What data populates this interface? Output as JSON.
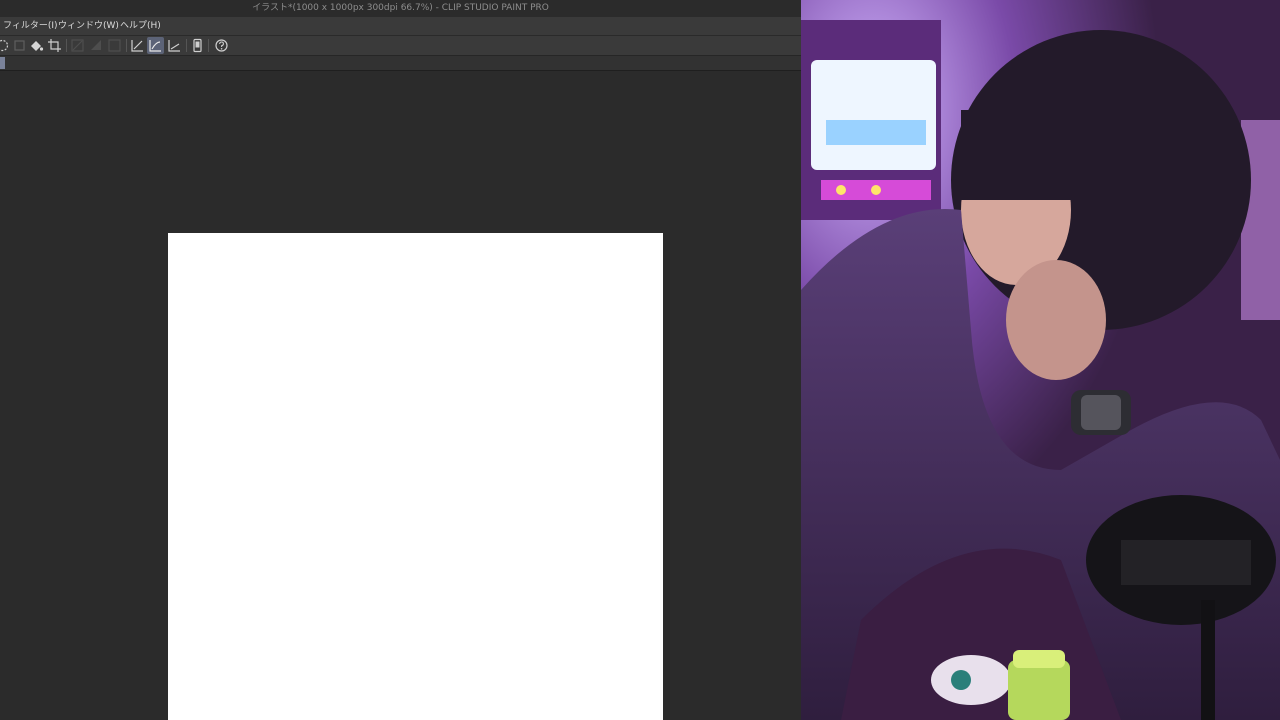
{
  "window": {
    "title": "イラスト*(1000 x 1000px 300dpi 66.7%) - CLIP STUDIO PAINT PRO"
  },
  "menu": {
    "items": [
      {
        "label": "フィルター(I)"
      },
      {
        "label": "ウィンドウ(W)"
      },
      {
        "label": "ヘルプ(H)"
      }
    ]
  },
  "toolbar": {
    "icons": [
      "rotate-icon",
      "disabled-icon",
      "fill-icon",
      "crop-icon",
      "disabled-icon-2",
      "disabled-icon-3",
      "disabled-icon-4",
      "ruler-icon",
      "stabilizer-icon",
      "line-icon",
      "device-icon",
      "help-icon"
    ],
    "active_icon": "stabilizer-icon"
  },
  "colors": {
    "app_bg": "#2b2b2b",
    "menubar_bg": "#3a3a3a",
    "active_tool": "#5c6377",
    "canvas": "#ffffff",
    "webcam_tint": "#6b3f8f"
  },
  "webcam": {
    "description_icon": "streamer-webcam-feed"
  }
}
